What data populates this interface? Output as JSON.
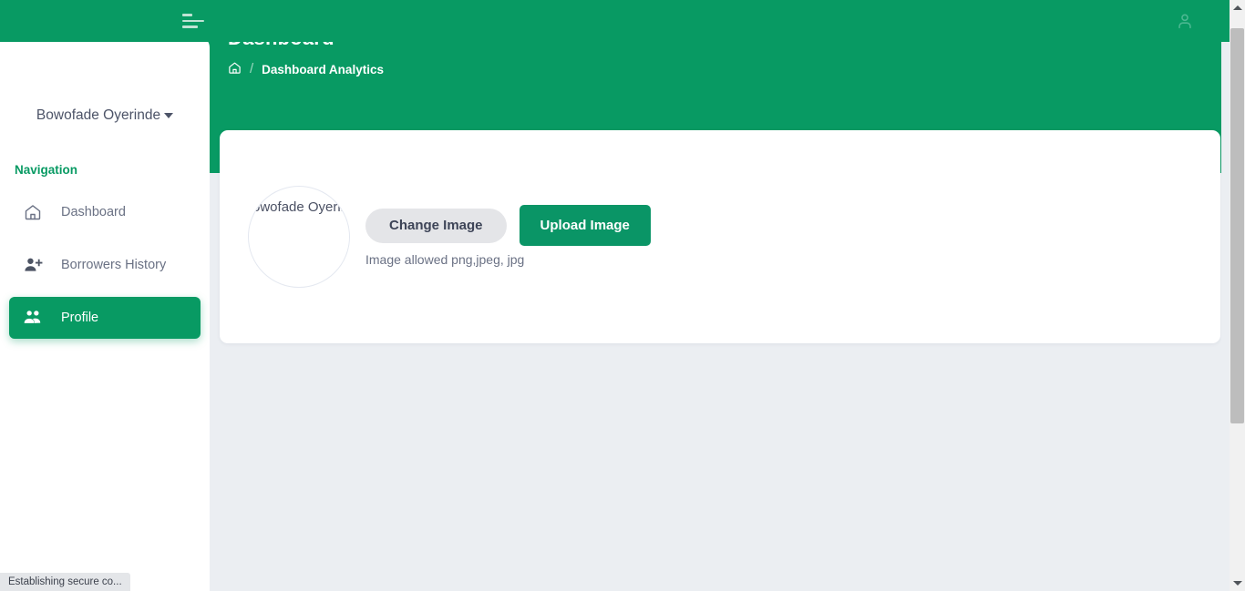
{
  "appbar": {
    "menu_icon": "hamburger-icon",
    "user_icon": "user-account-icon"
  },
  "header": {
    "title": "Dashboard",
    "breadcrumb": {
      "home_icon": "home-icon",
      "separator": "/",
      "current": "Dashboard Analytics"
    }
  },
  "sidebar": {
    "user_name": "Bowofade Oyerinde",
    "nav_heading": "Navigation",
    "items": [
      {
        "label": "Dashboard",
        "icon": "home-icon",
        "active": false
      },
      {
        "label": "Borrowers History",
        "icon": "person-add-icon",
        "active": false
      },
      {
        "label": "Profile",
        "icon": "people-group-icon",
        "active": true
      }
    ]
  },
  "card": {
    "avatar": {
      "alt_text": "Bowofade Oyerinde"
    },
    "change_image_label": "Change Image",
    "upload_image_label": "Upload Image",
    "hint": "Image allowed png,jpeg, jpg"
  },
  "browser": {
    "status_text": "Establishing secure co...",
    "scroll_up_icon": "triangle-up-icon",
    "scroll_down_icon": "triangle-down-icon"
  },
  "colors": {
    "brand_green": "#089a63",
    "button_green": "#0a9566",
    "page_background": "#ebeef2",
    "card_background": "#ffffff",
    "muted_text": "#6a7184"
  }
}
